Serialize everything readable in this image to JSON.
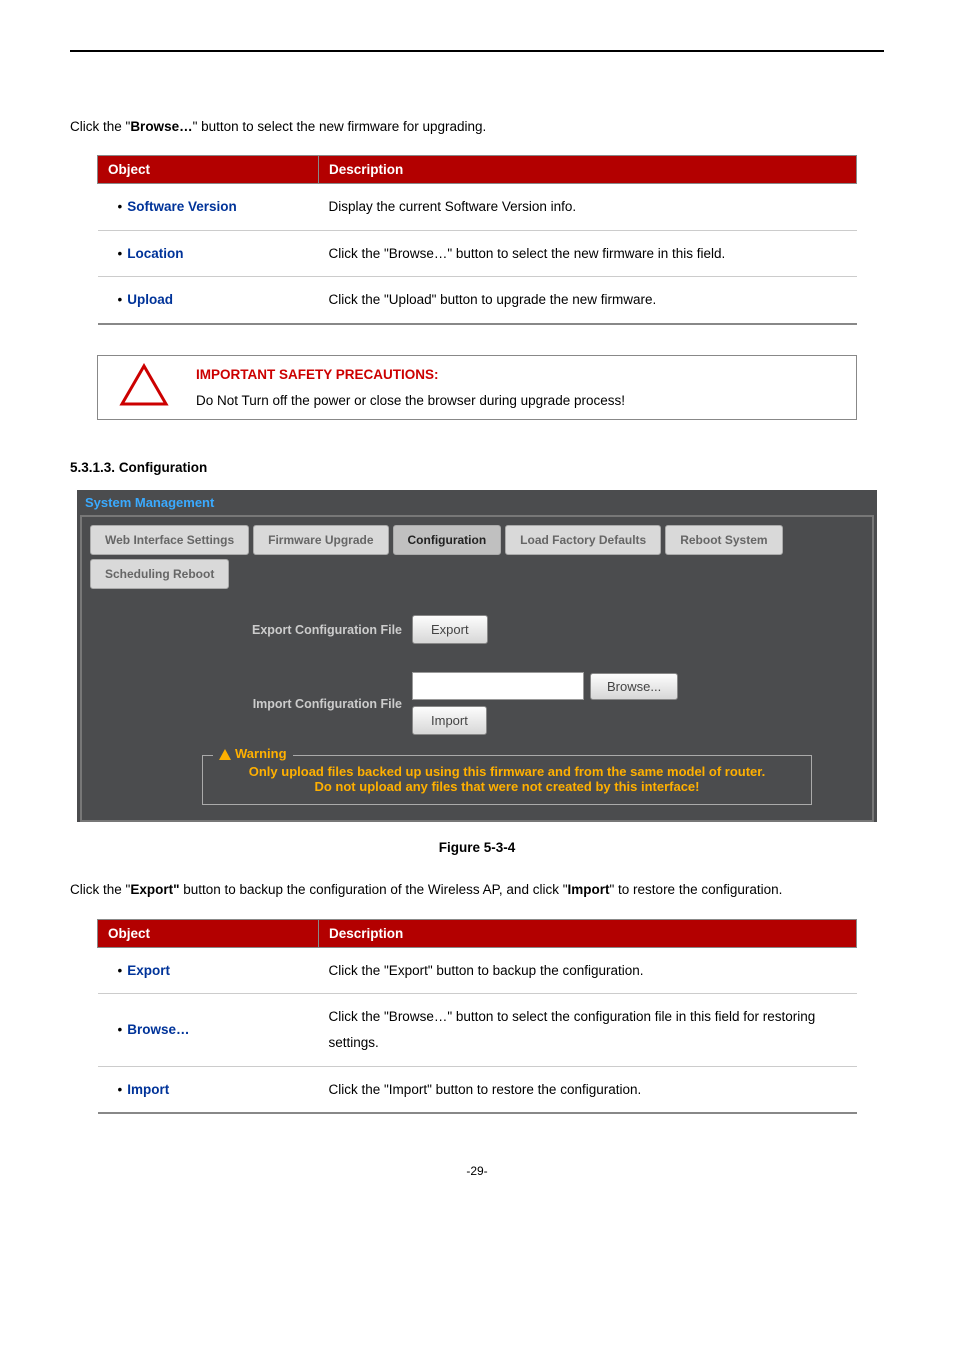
{
  "intro1_a": "Click the \"",
  "intro1_b": "Browse…",
  "intro1_c": "\" button to select the new firmware for upgrading.",
  "table1": {
    "col1": "Object",
    "col2": "Description",
    "rows": [
      {
        "label": "Software Version",
        "desc": "Display the current Software Version info."
      },
      {
        "label": "Location",
        "desc": "Click the \"Browse…\" button to select the new firmware in this field."
      },
      {
        "label": "Upload",
        "desc": "Click the \"Upload\" button to upgrade the new firmware."
      }
    ]
  },
  "warn": {
    "title": "IMPORTANT SAFETY PRECAUTIONS:",
    "body": "Do Not Turn off the power or close the browser during upgrade process!"
  },
  "section_num": "5.3.1.3.",
  "section_title": "Configuration",
  "panel": {
    "title": "System Management",
    "tabs": [
      "Web Interface Settings",
      "Firmware Upgrade",
      "Configuration",
      "Load Factory Defaults",
      "Reboot System",
      "Scheduling Reboot"
    ],
    "active_tab": "Configuration",
    "export_label": "Export Configuration File",
    "export_btn": "Export",
    "import_label": "Import Configuration File",
    "import_btn": "Import",
    "browse_btn": "Browse...",
    "warning_legend": "Warning",
    "warning_line1": "Only upload files backed up using this firmware and from the same model of router.",
    "warning_line2": "Do not upload any files that were not created by this interface!"
  },
  "fig_caption": "Figure 5-3-4",
  "intro2_a": "Click the \"",
  "intro2_b": "Export\"",
  "intro2_c": " button to backup the configuration of the Wireless AP, and click \"",
  "intro2_d": "Import",
  "intro2_e": "\" to restore the configuration.",
  "table2": {
    "col1": "Object",
    "col2": "Description",
    "rows": [
      {
        "label": "Export",
        "desc": "Click the \"Export\" button to backup the configuration."
      },
      {
        "label": "Browse…",
        "desc": "Click the \"Browse…\" button to select the configuration file in this field for restoring settings."
      },
      {
        "label": "Import",
        "desc": "Click the \"Import\" button to restore the configuration."
      }
    ]
  },
  "pagenum": "-29-"
}
